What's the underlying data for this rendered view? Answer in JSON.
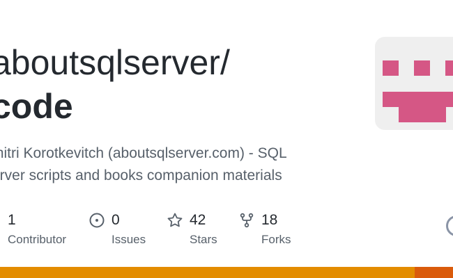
{
  "repo": {
    "owner": "aboutsqlserver/",
    "name": "code",
    "description_lines": [
      "mitri Korotkevitch (aboutsqlserver.com) - SQL",
      "erver scripts and books companion materials"
    ]
  },
  "stats": {
    "contributors": {
      "value": "1",
      "label": "Contributor",
      "icon": "people-icon"
    },
    "issues": {
      "value": "0",
      "label": "Issues",
      "icon": "issue-icon"
    },
    "stars": {
      "value": "42",
      "label": "Stars",
      "icon": "star-icon"
    },
    "forks": {
      "value": "18",
      "label": "Forks",
      "icon": "fork-icon"
    }
  },
  "avatar": {
    "icon": "identicon",
    "color": "#d55785",
    "background": "#efefef"
  },
  "language_bar": [
    {
      "color": "#e38c00",
      "share": 0.915
    },
    {
      "color": "#da5b0b",
      "share": 0.085
    }
  ]
}
